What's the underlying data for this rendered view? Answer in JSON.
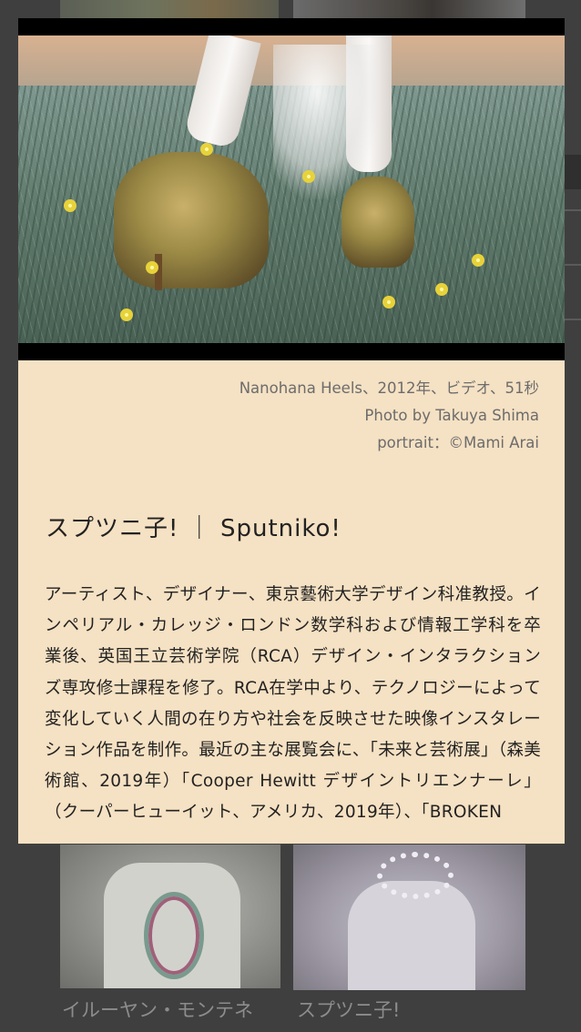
{
  "modal": {
    "image_alt": "Nanohana Heels video still",
    "caption_lines": [
      "Nanohana Heels、2012年、ビデオ、51秒",
      "Photo by Takuya Shima",
      "portrait：©Mami Arai"
    ],
    "artist_name": "スプツニ子! ｜ Sputniko!",
    "bio": "アーティスト、デザイナー、東京藝術大学デザイン科准教授。インペリアル・カレッジ・ロンドン数学科および情報工学科を卒業後、英国王立芸術学院（RCA）デザイン・インタラクションズ専攻修士課程を修了。RCA在学中より、テクノロジーによって変化していく人間の在り方や社会を反映させた映像インスタレーション作品を制作。最近の主な展覧会に、「未来と芸術展」（森美術館、2019年）「Cooper Hewitt デザイントリエンナーレ」（クーパーヒューイット、アメリカ、2019年）、「BROKEN"
  },
  "background": {
    "cards": [
      {
        "caption": "イルーヤン・モンテネ"
      },
      {
        "caption": "スプツニ子!"
      }
    ]
  },
  "colors": {
    "modal_background": "#f5e1c3",
    "page_background": "#3f3f3f"
  }
}
